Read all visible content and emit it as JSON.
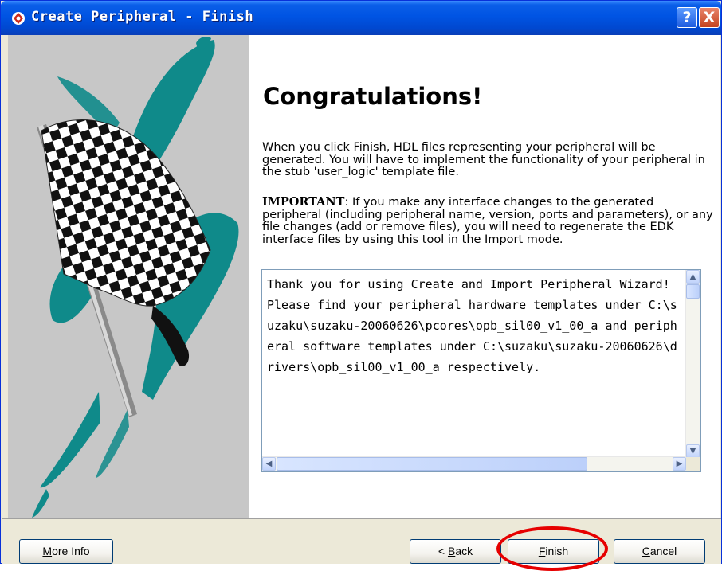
{
  "window": {
    "title": "Create Peripheral - Finish",
    "help_label": "?",
    "close_label": "X"
  },
  "content": {
    "heading": "Congratulations!",
    "paragraph1": "When you click Finish, HDL files representing your peripheral will be generated. You will have to implement the functionality of your peripheral in the stub 'user_logic' template file.",
    "important_label": "IMPORTANT",
    "paragraph2_rest": ": If you make any interface changes to the generated peripheral (including peripheral name, version, ports and parameters), or any file changes (add or remove files), you will need to regenerate the EDK interface files by using this tool in the Import mode.",
    "message": "Thank you for using Create and Import Peripheral Wizard! Please find your peripheral hardware templates under C:\\suzaku\\suzaku-20060626\\pcores\\opb_sil00_v1_00_a and peripheral software templates under C:\\suzaku\\suzaku-20060626\\drivers\\opb_sil00_v1_00_a respectively."
  },
  "buttons": {
    "more_info": {
      "u": "M",
      "rest": "ore Info"
    },
    "back": {
      "pre": "< ",
      "u": "B",
      "rest": "ack"
    },
    "finish": {
      "u": "F",
      "rest": "inish"
    },
    "cancel": {
      "u": "C",
      "rest": "ancel"
    }
  },
  "colors": {
    "titlebar": "#0054e3",
    "flag_accent": "#0f8a8a",
    "annotation": "#e60000"
  },
  "icons": [
    "wizard-app-icon",
    "checkered-flag-icon",
    "scroll-up-icon",
    "scroll-down-icon",
    "scroll-left-icon",
    "scroll-right-icon"
  ]
}
